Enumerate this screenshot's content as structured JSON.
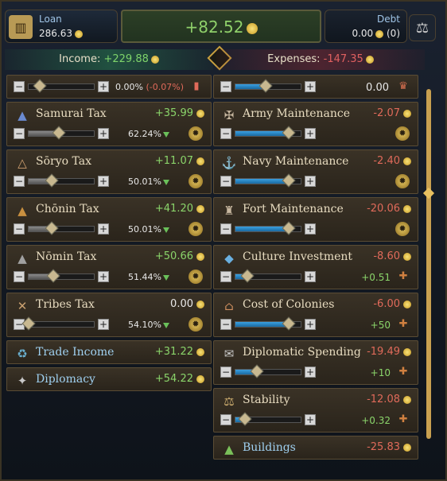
{
  "topbar": {
    "loan_label": "Loan",
    "loan_value": "286.63",
    "balance": "+82.52",
    "debt_label": "Debt",
    "debt_value": "0.00",
    "debt_count": "(0)"
  },
  "summary": {
    "income_label": "Income:",
    "income_value": "+229.88",
    "expenses_label": "Expenses:",
    "expenses_value": "-147.35"
  },
  "income": {
    "top_partial": {
      "pct": "0.00%",
      "delta": "(-0.07%)",
      "fill": 0.0
    },
    "items": [
      {
        "name": "Samurai Tax",
        "amount": "+35.99",
        "pct": "62.24%",
        "fill": 0.45,
        "icon": "samurai-icon"
      },
      {
        "name": "Sōryo Tax",
        "amount": "+11.07",
        "pct": "50.01%",
        "fill": 0.35,
        "icon": "soryo-icon"
      },
      {
        "name": "Chōnin Tax",
        "amount": "+41.20",
        "pct": "50.01%",
        "fill": 0.35,
        "icon": "chonin-icon"
      },
      {
        "name": "Nōmin Tax",
        "amount": "+50.66",
        "pct": "51.44%",
        "fill": 0.37,
        "icon": "nomin-icon"
      },
      {
        "name": "Tribes Tax",
        "amount": "0.00",
        "pct": "54.10%",
        "fill": 0.0,
        "icon": "tribes-icon"
      }
    ],
    "trade_income": {
      "name": "Trade Income",
      "amount": "+31.22"
    },
    "diplomacy": {
      "name": "Diplomacy",
      "amount": "+54.22"
    }
  },
  "expenses": {
    "top_partial": {
      "amount": "0.00",
      "fill": 0.45
    },
    "items": [
      {
        "name": "Army Maintenance",
        "amount": "-2.07",
        "fill": 0.8,
        "side_value": "",
        "icon": "army-icon"
      },
      {
        "name": "Navy Maintenance",
        "amount": "-2.40",
        "fill": 0.8,
        "side_value": "",
        "icon": "navy-icon"
      },
      {
        "name": "Fort Maintenance",
        "amount": "-20.06",
        "fill": 0.8,
        "side_value": "",
        "icon": "fort-icon"
      },
      {
        "name": "Culture Investment",
        "amount": "-8.60",
        "fill": 0.18,
        "side_value": "+0.51",
        "icon": "culture-icon"
      },
      {
        "name": "Cost of Colonies",
        "amount": "-6.00",
        "fill": 0.8,
        "side_value": "+50",
        "icon": "colonies-icon"
      },
      {
        "name": "Diplomatic Spending",
        "amount": "-19.49",
        "fill": 0.32,
        "side_value": "+10",
        "icon": "diplomatic-icon"
      },
      {
        "name": "Stability",
        "amount": "-12.08",
        "fill": 0.14,
        "side_value": "+0.32",
        "icon": "stability-icon"
      }
    ],
    "buildings": {
      "name": "Buildings",
      "amount": "-25.83"
    }
  },
  "colors": {
    "positive": "#8ad46a",
    "negative": "#e06a5a",
    "slider": "#3aa0e0",
    "gold": "#c8a040"
  }
}
